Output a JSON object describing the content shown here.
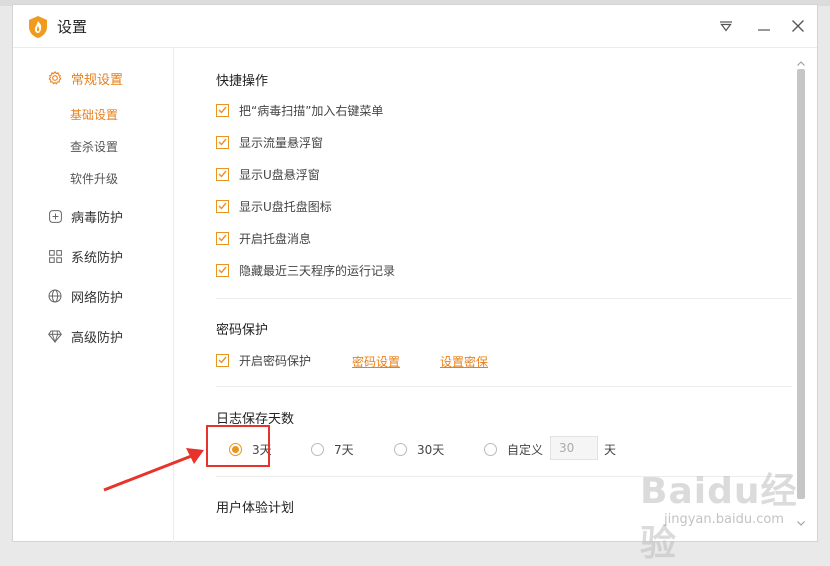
{
  "window": {
    "title": "设置"
  },
  "sidebar": {
    "items": [
      {
        "label": "常规设置",
        "icon": "gear-icon",
        "active": true,
        "children": [
          {
            "label": "基础设置",
            "active": true
          },
          {
            "label": "查杀设置",
            "active": false
          },
          {
            "label": "软件升级",
            "active": false
          }
        ]
      },
      {
        "label": "病毒防护",
        "icon": "plus-square-icon"
      },
      {
        "label": "系统防护",
        "icon": "grid-icon"
      },
      {
        "label": "网络防护",
        "icon": "globe-icon"
      },
      {
        "label": "高级防护",
        "icon": "diamond-icon"
      }
    ]
  },
  "content": {
    "quick": {
      "title": "快捷操作",
      "options": [
        {
          "label": "把“病毒扫描”加入右键菜单",
          "checked": true
        },
        {
          "label": "显示流量悬浮窗",
          "checked": true
        },
        {
          "label": "显示U盘悬浮窗",
          "checked": true
        },
        {
          "label": "显示U盘托盘图标",
          "checked": true
        },
        {
          "label": "开启托盘消息",
          "checked": true
        },
        {
          "label": "隐藏最近三天程序的运行记录",
          "checked": true
        }
      ]
    },
    "password": {
      "title": "密码保护",
      "enable_label": "开启密码保护",
      "checked": true,
      "link_set": "密码设置",
      "link_secret": "设置密保"
    },
    "log": {
      "title": "日志保存天数",
      "options": [
        {
          "label": "3天",
          "selected": true
        },
        {
          "label": "7天",
          "selected": false
        },
        {
          "label": "30天",
          "selected": false
        },
        {
          "label": "自定义",
          "selected": false
        }
      ],
      "custom_value": "30",
      "custom_unit": "天"
    },
    "experience": {
      "title": "用户体验计划"
    }
  },
  "colors": {
    "accent": "#e8801a",
    "checkbox": "#e8951f",
    "highlight": "#e8322b"
  },
  "watermark": {
    "brand": "Baidu经验",
    "url": "jingyan.baidu.com"
  }
}
